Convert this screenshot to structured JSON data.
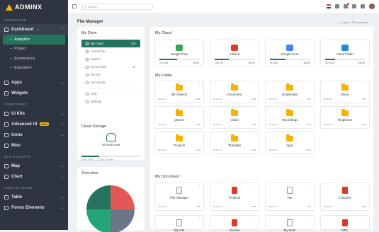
{
  "brand": {
    "name": "ADMINX",
    "accent": "#25745f",
    "logo_color": "#f4b400"
  },
  "sidebar": {
    "section_dashboard": "DASHBOARD",
    "dashboard_label": "Dashboard",
    "sub_items": [
      "Analytics",
      "Project",
      "Ecommerce",
      "Education"
    ],
    "apps_label": "Apps",
    "widgets_label": "Widgets",
    "section_component": "COMPONENT",
    "uikits_label": "UI Kits",
    "advanced_label": "Advanced UI",
    "advanced_badge": "New",
    "icons_label": "Icons",
    "misc_label": "Misc",
    "section_map": "MAP & CHARTS",
    "map_label": "Map",
    "chart_label": "Chart",
    "section_table": "TABLE & FORMS",
    "table_label": "Table",
    "forms_label": "Forms Elements"
  },
  "topbar": {
    "search_placeholder": "Search",
    "notification_count": ""
  },
  "page": {
    "title": "File Manager",
    "crumb_apps": "Apps",
    "crumb_current": "File manager"
  },
  "my_drive": {
    "title": "My Drive",
    "items": [
      {
        "label": "My Cloud",
        "count": "10+"
      },
      {
        "label": "Shared file",
        "count": ""
      },
      {
        "label": "Starred",
        "count": ""
      },
      {
        "label": "Recycle Bin",
        "count": "3+"
      },
      {
        "label": "Recent",
        "count": ""
      },
      {
        "label": "Documents",
        "count": ""
      },
      {
        "label": "Help",
        "count": ""
      },
      {
        "label": "Settings",
        "count": ""
      }
    ]
  },
  "cloud_storage": {
    "title": "Cloud Storage",
    "used_text": "30.90GB used",
    "fill": 0.3,
    "footer": "30% Used – 32.30GB Free"
  },
  "overview": {
    "title": "Overview"
  },
  "my_cloud": {
    "title": "My Cloud",
    "cards": [
      {
        "name": "Google Drive",
        "used": "20.5 GB",
        "total": "50GB",
        "fill": 0.45,
        "color": "#34a853"
      },
      {
        "name": "AdminX",
        "used": "20.5 GB",
        "total": "50GB",
        "fill": 0.35,
        "color": "#d93b2a"
      },
      {
        "name": "Google cloud",
        "used": "21.5GB",
        "total": "50GB",
        "fill": 0.4,
        "color": "#4285f4"
      },
      {
        "name": "Cloud Folder",
        "used": "46.5 GB",
        "total": "100GB",
        "fill": 0.25,
        "color": "#1e88e5"
      }
    ]
  },
  "my_folder": {
    "title": "My Folder",
    "folders": [
      {
        "name": "3D Objects",
        "date": "20-01-24",
        "size": "10GB"
      },
      {
        "name": "Document",
        "date": "20-01-24",
        "size": "2GB"
      },
      {
        "name": "Downloads",
        "date": "20-01-24",
        "size": "5GB"
      },
      {
        "name": "Music",
        "date": "20-01-24",
        "size": "1GB"
      },
      {
        "name": "picture",
        "date": "20-01-24",
        "size": "3GB"
      },
      {
        "name": "Video",
        "date": "20-01-24",
        "size": "7GB"
      },
      {
        "name": "Recordings",
        "date": "20-01-24",
        "size": "4GB"
      },
      {
        "name": "Ringtones",
        "date": "20-01-24",
        "size": "1GB"
      },
      {
        "name": "Projects",
        "date": "20-01-24",
        "size": "6GB"
      },
      {
        "name": "Template",
        "date": "20-01-24",
        "size": "2GB"
      },
      {
        "name": "Apps",
        "date": "20-01-24",
        "size": "12GB"
      }
    ]
  },
  "my_document": {
    "title": "My Document",
    "docs": [
      {
        "name": "File manager",
        "date": "20-01-24",
        "size": "1MB",
        "type": "gray"
      },
      {
        "name": "Projects",
        "date": "20-01-24",
        "size": "2MB",
        "type": "red"
      },
      {
        "name": "Tex",
        "date": "20-01-24",
        "size": "1MB",
        "type": "gray"
      },
      {
        "name": "Cubozer",
        "date": "20-01-24",
        "size": "3MB",
        "type": "red"
      },
      {
        "name": "My File",
        "date": "20-01-24",
        "size": "1MB",
        "type": "gray"
      },
      {
        "name": "Scores",
        "date": "20-01-24",
        "size": "2MB",
        "type": "red"
      },
      {
        "name": "My Note",
        "date": "20-01-24",
        "size": "1MB",
        "type": "gray"
      },
      {
        "name": "MDL",
        "date": "20-01-24",
        "size": "2MB",
        "type": "red"
      }
    ]
  },
  "chart_data": {
    "type": "pie",
    "title": "",
    "values": [
      25,
      25,
      25,
      25
    ],
    "colors": [
      "#e45757",
      "#6b7688",
      "#25a57a",
      "#25745f"
    ]
  }
}
